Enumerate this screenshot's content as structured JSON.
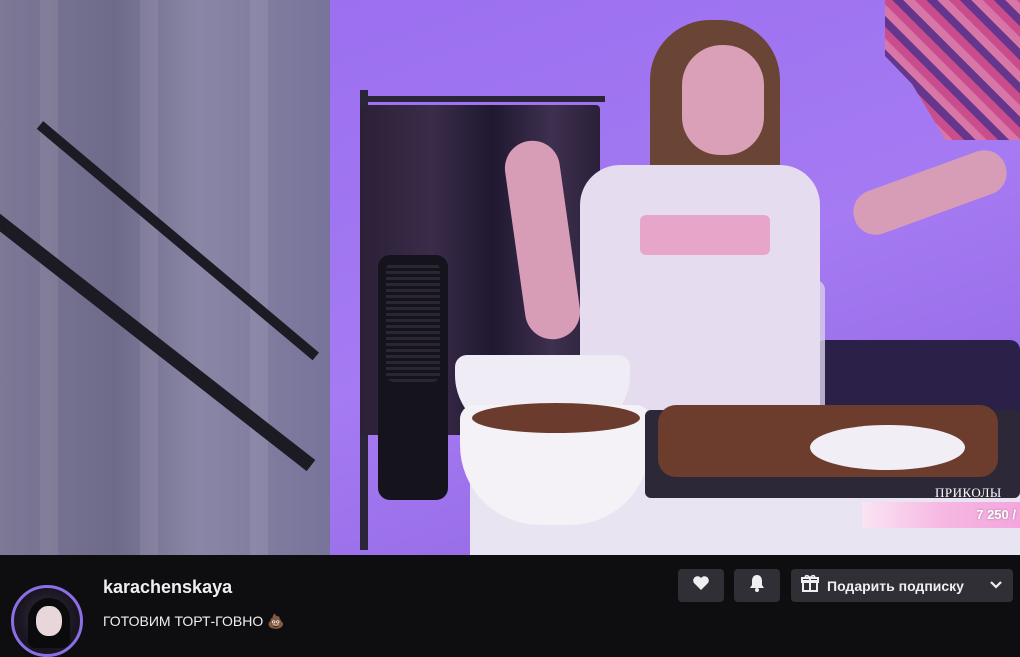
{
  "video": {
    "overlay_label": "ПРИКОЛЫ",
    "overlay_value": "7 250 /"
  },
  "channel": {
    "name": "karachenskaya",
    "stream_title": "ГОТОВИМ ТОРТ-ГОВНО 💩",
    "avatar_icon": "streamer-avatar"
  },
  "actions": {
    "follow_icon": "heart-icon",
    "notify_icon": "bell-icon",
    "gift_icon": "gift-icon",
    "gift_label": "Подарить подписку",
    "gift_dropdown_icon": "chevron-down-icon"
  },
  "colors": {
    "background": "#0e0e10",
    "button": "#2f2f35",
    "text": "#efeff1",
    "accent": "#8a6fe6"
  }
}
